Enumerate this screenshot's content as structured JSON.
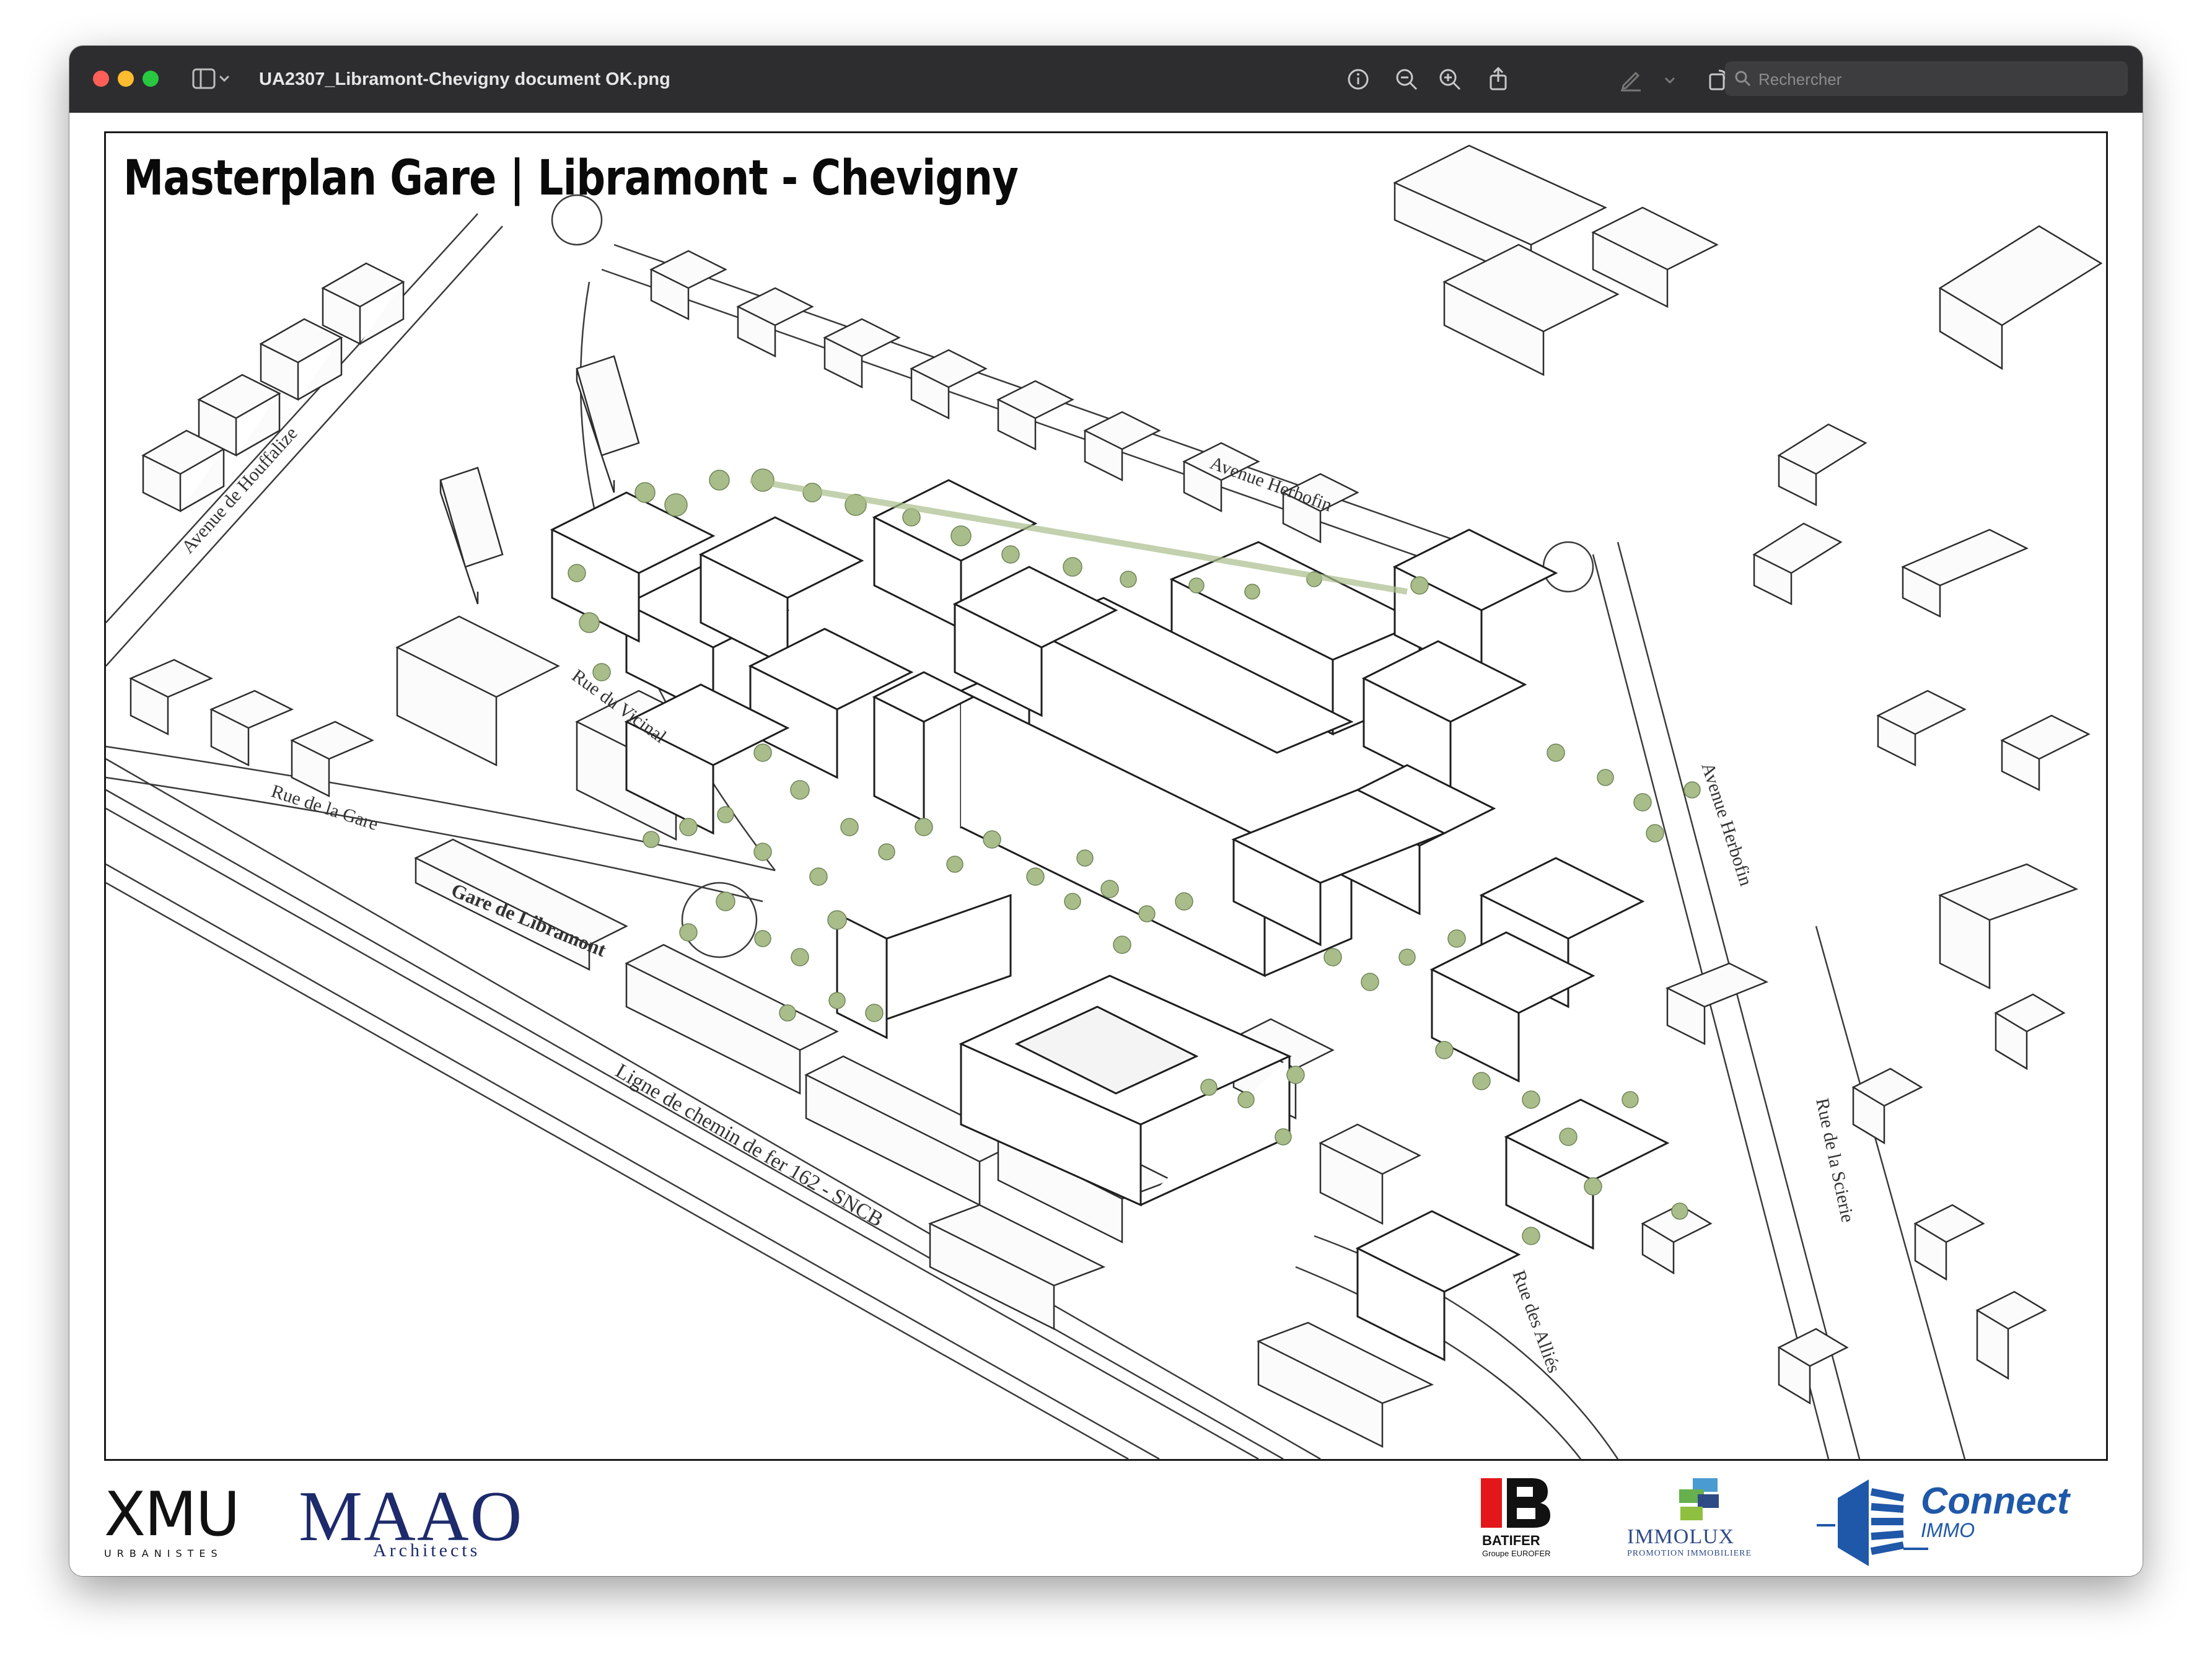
{
  "window": {
    "title": "UA2307_Libramont-Chevigny document OK.png",
    "search_placeholder": "Rechercher"
  },
  "toolbar": {
    "icons": [
      "info-icon",
      "zoom-out-icon",
      "zoom-in-icon",
      "share-icon",
      "markup-pen-icon",
      "chevron-down-icon",
      "rotate-icon",
      "annotate-icon",
      "search-icon"
    ]
  },
  "plan": {
    "title": "Masterplan Gare | Libramont - Chevigny",
    "street_labels": {
      "avenue_houffalize": "Avenue de Houffalize",
      "avenue_herbofin_top": "Avenue Herbofin",
      "avenue_herbofin_right": "Avenue Herbofin",
      "rue_vicinal": "Rue du Vicinal",
      "rue_gare": "Rue de la Gare",
      "gare_libramont": "Gare de Libramont",
      "railway": "Ligne de chemin de fer 162 - SNCB",
      "rue_allies": "Rue des Alliés",
      "rue_scierie": "Rue de la Scierie"
    }
  },
  "logos": {
    "xmu": {
      "name": "XMU",
      "sub": "URBANISTES"
    },
    "maao": {
      "name": "MAAO",
      "sub": "Architects"
    },
    "batifer": {
      "name": "BATIFER",
      "sub": "Groupe EUROFER"
    },
    "immolux": {
      "name": "IMMOLUX",
      "sub": "PROMOTION IMMOBILIERE"
    },
    "connect": {
      "name": "Connect",
      "sub": "IMMO"
    }
  },
  "colors": {
    "titlebar": "#2d2d2f",
    "tree_green": "#a9bd8b",
    "maao_blue": "#1d2a6b",
    "connect_blue": "#1f58a8",
    "batifer_red": "#e3161b"
  }
}
